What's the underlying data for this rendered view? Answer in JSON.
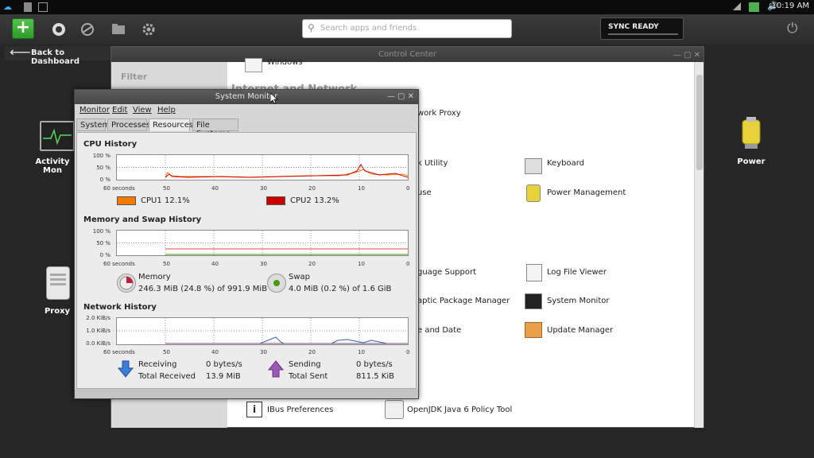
{
  "statusbar": {
    "time": "10:19 AM"
  },
  "toolbar": {
    "search_placeholder": "Search apps and friends",
    "sync_label": "SYNC READY"
  },
  "back": {
    "label": "Back to Dashboard"
  },
  "desktop": {
    "icons": [
      {
        "label": "Activity Mon"
      },
      {
        "label": "Proxy"
      },
      {
        "label": "Power"
      }
    ]
  },
  "control_center": {
    "title": "Control Center",
    "filter_label": "Filter",
    "windows_label": "Windows",
    "section_title": "Internet and Network",
    "items": {
      "network_proxy": "work Proxy",
      "disk_utility": "k Utility",
      "mouse": "use",
      "keyboard": "Keyboard",
      "power_management": "Power Management",
      "language_support": "guage Support",
      "log_file_viewer": "Log File Viewer",
      "synaptic": "aptic Package Manager",
      "system_monitor": "System Monitor",
      "time_date": "e and Date",
      "update_manager": "Update Manager",
      "ibus": "IBus Preferences",
      "openjdk": "OpenJDK Java 6 Policy Tool"
    }
  },
  "system_monitor": {
    "title": "System Monitor",
    "menus": [
      "Monitor",
      "Edit",
      "View",
      "Help"
    ],
    "tabs": [
      "System",
      "Processes",
      "Resources",
      "File Systems"
    ],
    "active_tab": "Resources",
    "x_ticks": [
      "60 seconds",
      "50",
      "40",
      "30",
      "20",
      "10",
      "0"
    ],
    "cpu": {
      "title": "CPU History",
      "y_ticks": [
        "100 %",
        "50 %",
        "0 %"
      ],
      "cpu1_label": "CPU1",
      "cpu1_value": "12.1%",
      "cpu1_color": "#f57900",
      "cpu2_label": "CPU2",
      "cpu2_value": "13.2%",
      "cpu2_color": "#cc0000"
    },
    "memory": {
      "title": "Memory and Swap History",
      "y_ticks": [
        "100 %",
        "50 %",
        "0 %"
      ],
      "memory_label": "Memory",
      "memory_value": "246.3 MiB (24.8 %) of 991.9 MiB",
      "swap_label": "Swap",
      "swap_value": "4.0 MiB (0.2 %) of 1.6 GiB"
    },
    "network": {
      "title": "Network History",
      "y_ticks": [
        "2.0 KiB/s",
        "1.0 KiB/s",
        "0.0 KiB/s"
      ],
      "receiving_label": "Receiving",
      "receiving_value": "0 bytes/s",
      "total_received_label": "Total Received",
      "total_received_value": "13.9 MiB",
      "sending_label": "Sending",
      "sending_value": "0 bytes/s",
      "total_sent_label": "Total Sent",
      "total_sent_value": "811.5 KiB"
    }
  }
}
